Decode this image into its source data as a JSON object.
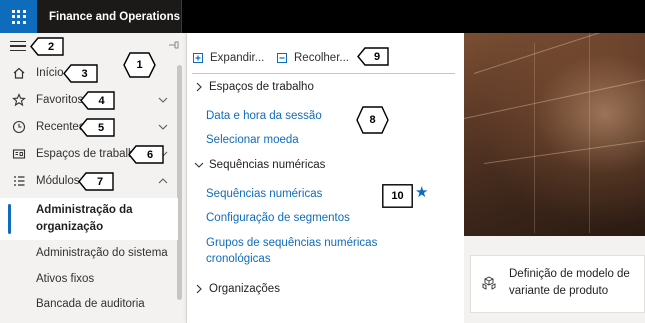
{
  "app": {
    "title": "Finance and Operations"
  },
  "sidebar": {
    "items": [
      {
        "label": "Início",
        "icon": "home-icon"
      },
      {
        "label": "Favoritos",
        "icon": "star-outline-icon"
      },
      {
        "label": "Recentes",
        "icon": "clock-icon"
      },
      {
        "label": "Espaços de trabalho",
        "icon": "workspace-icon"
      },
      {
        "label": "Módulos",
        "icon": "modules-list-icon"
      }
    ],
    "modules": [
      {
        "label": "Administração da organização",
        "selected": true
      },
      {
        "label": "Administração do sistema"
      },
      {
        "label": "Ativos fixos"
      },
      {
        "label": "Bancada de auditoria"
      }
    ]
  },
  "flyout": {
    "expand_label": "Expandir...",
    "collapse_label": "Recolher...",
    "groups": [
      {
        "label": "Espaços de trabalho",
        "expanded": false
      },
      {
        "label": "Sequências numéricas",
        "expanded": true
      },
      {
        "label": "Organizações",
        "expanded": false
      }
    ],
    "workspace_links": [
      "Data e hora da sessão",
      "Selecionar moeda"
    ],
    "sequence_links": [
      "Sequências numéricas",
      "Configuração de segmentos",
      "Grupos de sequências numéricas cronológicas"
    ]
  },
  "tile": {
    "title": "Definição de modelo de variante de produto"
  },
  "callouts": [
    "1",
    "2",
    "3",
    "4",
    "5",
    "6",
    "7",
    "8",
    "9",
    "10"
  ],
  "colors": {
    "accent": "#0f6cbd",
    "topbar": "#000000",
    "sidebar_bg": "#f3f2f1"
  }
}
